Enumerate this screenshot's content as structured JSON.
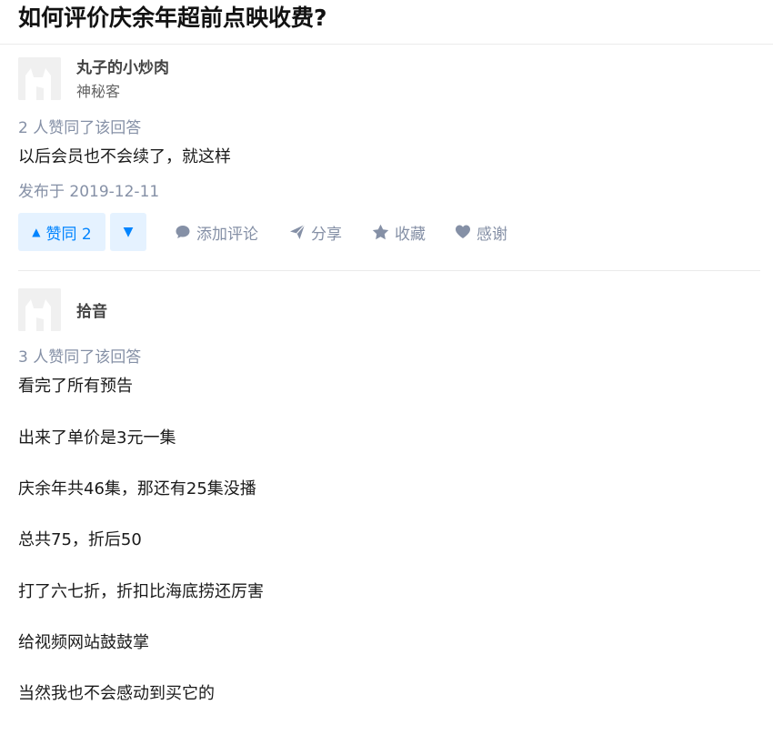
{
  "question": {
    "title": "如何评价庆余年超前点映收费?"
  },
  "answers": [
    {
      "author_name": "丸子的小炒肉",
      "author_headline": "神秘客",
      "votes_text": "2 人赞同了该回答",
      "content": [
        "以后会员也不会续了，就这样"
      ],
      "published": "发布于 2019-12-11",
      "actions": {
        "upvote_arrow": "▲",
        "upvote_label": "赞同 2",
        "downvote_arrow": "▼",
        "comment": "添加评论",
        "share": "分享",
        "collect": "收藏",
        "thanks": "感谢"
      }
    },
    {
      "author_name": "拾音",
      "votes_text": "3 人赞同了该回答",
      "content": [
        "看完了所有预告",
        "出来了单价是3元一集",
        "庆余年共46集，那还有25集没播",
        "总共75，折后50",
        "打了六七折，折扣比海底捞还厉害",
        "给视频网站鼓鼓掌",
        "当然我也不会感动到买它的"
      ]
    }
  ],
  "colors": {
    "accent": "#0084ff",
    "accent_bg": "#e5f2ff",
    "muted": "#8590a6"
  },
  "icons": {
    "avatar": "default-avatar-icon",
    "comment": "comment-icon",
    "share": "share-icon",
    "collect": "star-icon",
    "thanks": "heart-icon"
  }
}
